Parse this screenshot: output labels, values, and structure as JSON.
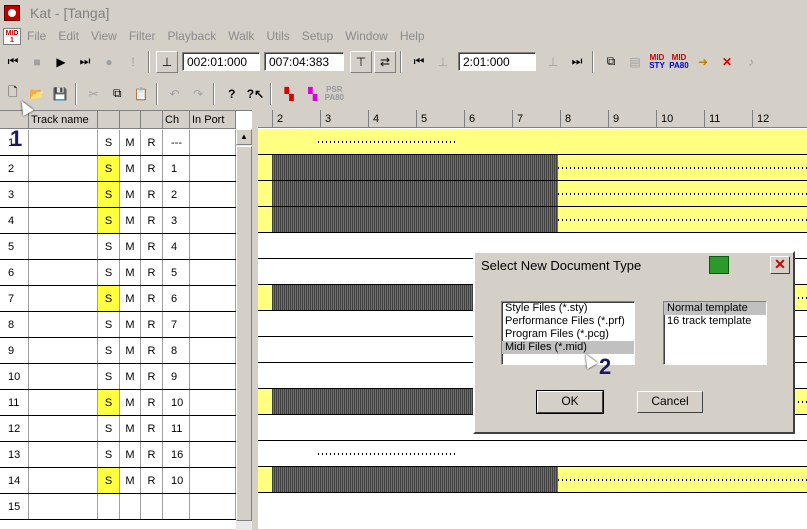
{
  "window": {
    "title": "Kat - [Tanga]"
  },
  "menu": [
    "File",
    "Edit",
    "View",
    "Filter",
    "Playback",
    "Walk",
    "Utils",
    "Setup",
    "Window",
    "Help"
  ],
  "transport": {
    "position": "002:01:000",
    "length": "007:04:383",
    "loop_position": "2:01:000"
  },
  "badges": {
    "mid_sty": [
      "MID",
      "STY"
    ],
    "mid_pa80": [
      "MID",
      "PA80"
    ],
    "psr_pa80": [
      "PSR",
      "PA80"
    ]
  },
  "track_headers": {
    "name": "Track name",
    "ch": "Ch",
    "port": "In Port"
  },
  "tracks": [
    {
      "num": "1",
      "s": "S",
      "m": "M",
      "r": "R",
      "ch": "---",
      "solo": false
    },
    {
      "num": "2",
      "s": "S",
      "m": "M",
      "r": "R",
      "ch": "1",
      "solo": true
    },
    {
      "num": "3",
      "s": "S",
      "m": "M",
      "r": "R",
      "ch": "2",
      "solo": true
    },
    {
      "num": "4",
      "s": "S",
      "m": "M",
      "r": "R",
      "ch": "3",
      "solo": true
    },
    {
      "num": "5",
      "s": "S",
      "m": "M",
      "r": "R",
      "ch": "4",
      "solo": false
    },
    {
      "num": "6",
      "s": "S",
      "m": "M",
      "r": "R",
      "ch": "5",
      "solo": false
    },
    {
      "num": "7",
      "s": "S",
      "m": "M",
      "r": "R",
      "ch": "6",
      "solo": true
    },
    {
      "num": "8",
      "s": "S",
      "m": "M",
      "r": "R",
      "ch": "7",
      "solo": false
    },
    {
      "num": "9",
      "s": "S",
      "m": "M",
      "r": "R",
      "ch": "8",
      "solo": false
    },
    {
      "num": "10",
      "s": "S",
      "m": "M",
      "r": "R",
      "ch": "9",
      "solo": false
    },
    {
      "num": "11",
      "s": "S",
      "m": "M",
      "r": "R",
      "ch": "10",
      "solo": true
    },
    {
      "num": "12",
      "s": "S",
      "m": "M",
      "r": "R",
      "ch": "11",
      "solo": false
    },
    {
      "num": "13",
      "s": "S",
      "m": "M",
      "r": "R",
      "ch": "16",
      "solo": false
    },
    {
      "num": "14",
      "s": "S",
      "m": "M",
      "r": "R",
      "ch": "10",
      "solo": true
    },
    {
      "num": "15",
      "s": "",
      "m": "",
      "r": "",
      "ch": "",
      "solo": false
    }
  ],
  "ruler": [
    "2",
    "3",
    "4",
    "5",
    "6",
    "7",
    "8",
    "9",
    "10",
    "11",
    "12"
  ],
  "dialog": {
    "title": "Select New Document Type",
    "file_types": [
      "Style Files (*.sty)",
      "Performance Files (*.prf)",
      "Program Files (*.pcg)",
      "Midi Files (*.mid)"
    ],
    "selected_file_type": 3,
    "templates": [
      "Normal template",
      "16 track template"
    ],
    "selected_template": 0,
    "ok": "OK",
    "cancel": "Cancel"
  },
  "annotations": {
    "one": "1",
    "two": "2"
  },
  "colors": {
    "solo": "#ffff40",
    "lane": "#ffff80"
  }
}
